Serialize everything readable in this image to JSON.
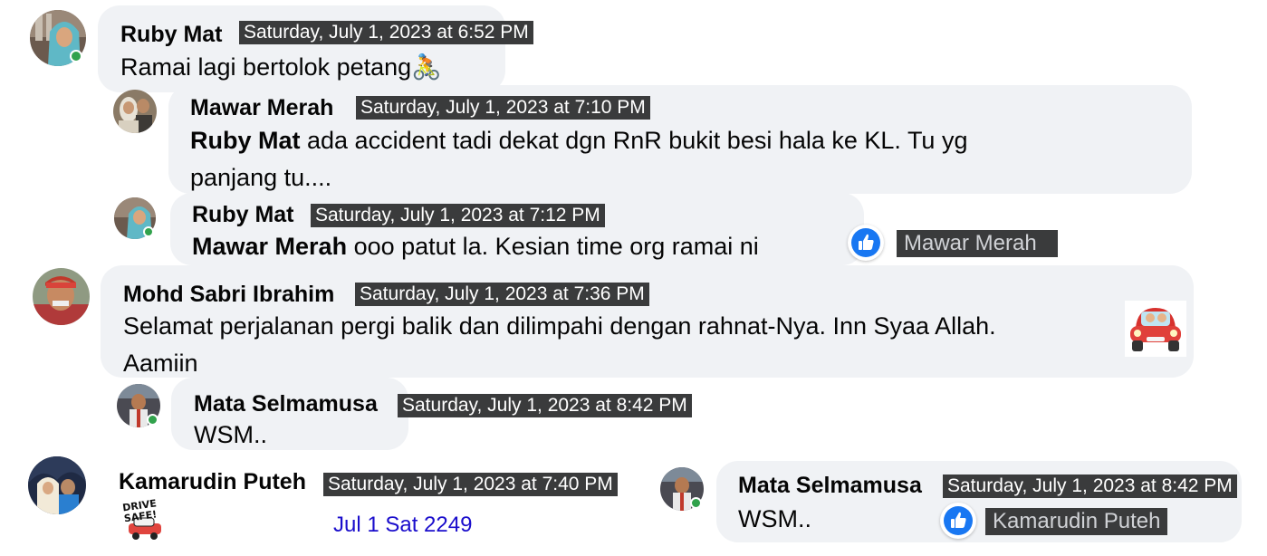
{
  "comments": [
    {
      "name": "Ruby Mat",
      "timestamp": "Saturday, July 1, 2023 at 6:52 PM",
      "text": "Ramai lagi bertolok petang",
      "emoji": "🚴"
    },
    {
      "name": "Mawar Merah",
      "timestamp": "Saturday, July 1, 2023 at 7:10 PM",
      "mention": "Ruby Mat",
      "text_line1": " ada accident tadi dekat dgn RnR bukit besi hala ke KL. Tu yg",
      "text_line2": "panjang tu...."
    },
    {
      "name": "Ruby Mat",
      "timestamp": "Saturday, July 1, 2023 at 7:12 PM",
      "mention": "Mawar Merah",
      "text": " ooo patut la. Kesian time org ramai ni",
      "reaction": "like",
      "reaction_tooltip": "Mawar Merah"
    },
    {
      "name": "Mohd Sabri Ibrahim",
      "timestamp": "Saturday, July 1, 2023 at 7:36 PM",
      "text_line1": "Selamat perjalanan pergi balik dan dilimpahi dengan rahnat-Nya. Inn Syaa Allah.",
      "text_line2": "Aamiin",
      "sticker": "car-sticker"
    },
    {
      "name": "Mata Selmamusa",
      "timestamp": "Saturday, July 1, 2023 at 8:42 PM",
      "text": "WSM.."
    },
    {
      "name": "Kamarudin Puteh",
      "timestamp": "Saturday, July 1, 2023 at 7:40 PM",
      "sticker_text": "DRIVE SAFE!"
    },
    {
      "name": "Mata Selmamusa",
      "timestamp": "Saturday, July 1, 2023 at 8:42 PM",
      "text": "WSM..",
      "reaction": "like",
      "reaction_tooltip": "Kamarudin Puteh"
    }
  ],
  "annotation": "Jul 1 Sat 2249",
  "colors": {
    "bubble": "#f0f2f5",
    "online": "#31a24c",
    "like": "#1877f2",
    "tooltip": "#3a3b3c",
    "annotation": "#1a0dcc"
  }
}
